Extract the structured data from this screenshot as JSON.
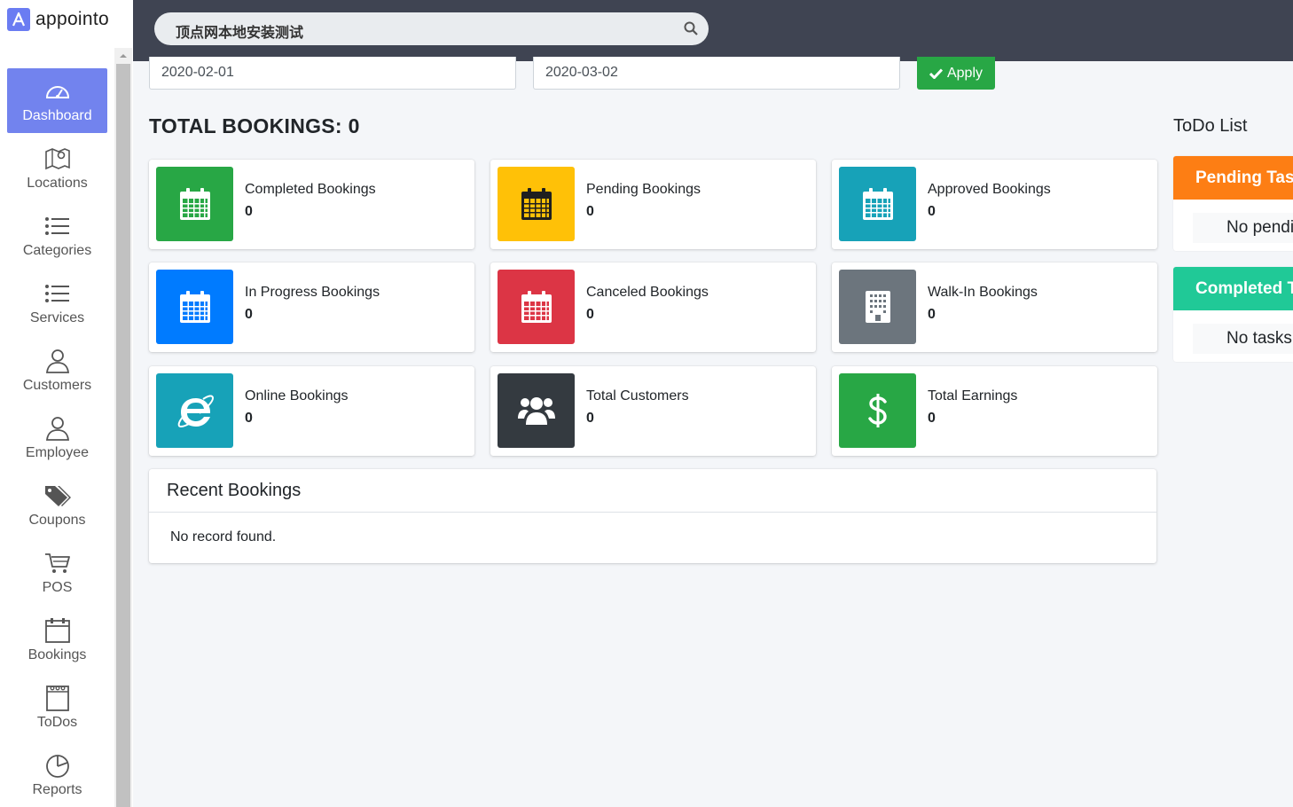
{
  "app": {
    "name": "appointo"
  },
  "search": {
    "value": "顶点网本地安装测试"
  },
  "filters": {
    "start_date": "2020-02-01",
    "end_date": "2020-03-02",
    "apply_label": "Apply"
  },
  "sidebar": {
    "items": [
      {
        "label": "Dashboard",
        "icon": "dashboard-icon",
        "active": true
      },
      {
        "label": "Locations",
        "icon": "map-icon"
      },
      {
        "label": "Categories",
        "icon": "list-icon"
      },
      {
        "label": "Services",
        "icon": "list-icon"
      },
      {
        "label": "Customers",
        "icon": "user-icon"
      },
      {
        "label": "Employee",
        "icon": "user-icon"
      },
      {
        "label": "Coupons",
        "icon": "tags-icon"
      },
      {
        "label": "POS",
        "icon": "cart-icon"
      },
      {
        "label": "Bookings",
        "icon": "calendar-icon"
      },
      {
        "label": "ToDos",
        "icon": "notepad-icon"
      },
      {
        "label": "Reports",
        "icon": "pie-chart-icon"
      }
    ]
  },
  "dashboard": {
    "total_title": "TOTAL BOOKINGS: 0",
    "cards": [
      {
        "label": "Completed Bookings",
        "value": "0",
        "color": "#28a745",
        "icon": "calendar-icon"
      },
      {
        "label": "Pending Bookings",
        "value": "0",
        "color": "#ffc107",
        "icon": "calendar-icon"
      },
      {
        "label": "Approved Bookings",
        "value": "0",
        "color": "#17a2b8",
        "icon": "calendar-icon"
      },
      {
        "label": "In Progress Bookings",
        "value": "0",
        "color": "#007bff",
        "icon": "calendar-icon"
      },
      {
        "label": "Canceled Bookings",
        "value": "0",
        "color": "#dc3545",
        "icon": "calendar-icon"
      },
      {
        "label": "Walk-In Bookings",
        "value": "0",
        "color": "#6c757d",
        "icon": "building-icon"
      },
      {
        "label": "Online Bookings",
        "value": "0",
        "color": "#17a2b8",
        "icon": "internet-explorer-icon"
      },
      {
        "label": "Total Customers",
        "value": "0",
        "color": "#343a40",
        "icon": "users-icon"
      },
      {
        "label": "Total Earnings",
        "value": "0",
        "color": "#28a745",
        "icon": "dollar-icon"
      }
    ],
    "recent": {
      "title": "Recent Bookings",
      "empty": "No record found."
    }
  },
  "todo": {
    "title": "ToDo List",
    "pending": {
      "title": "Pending Tasks",
      "empty": "No pending tasks",
      "color": "#fd7e14"
    },
    "completed": {
      "title": "Completed Tasks",
      "empty": "No tasks",
      "color": "#20c997"
    }
  }
}
